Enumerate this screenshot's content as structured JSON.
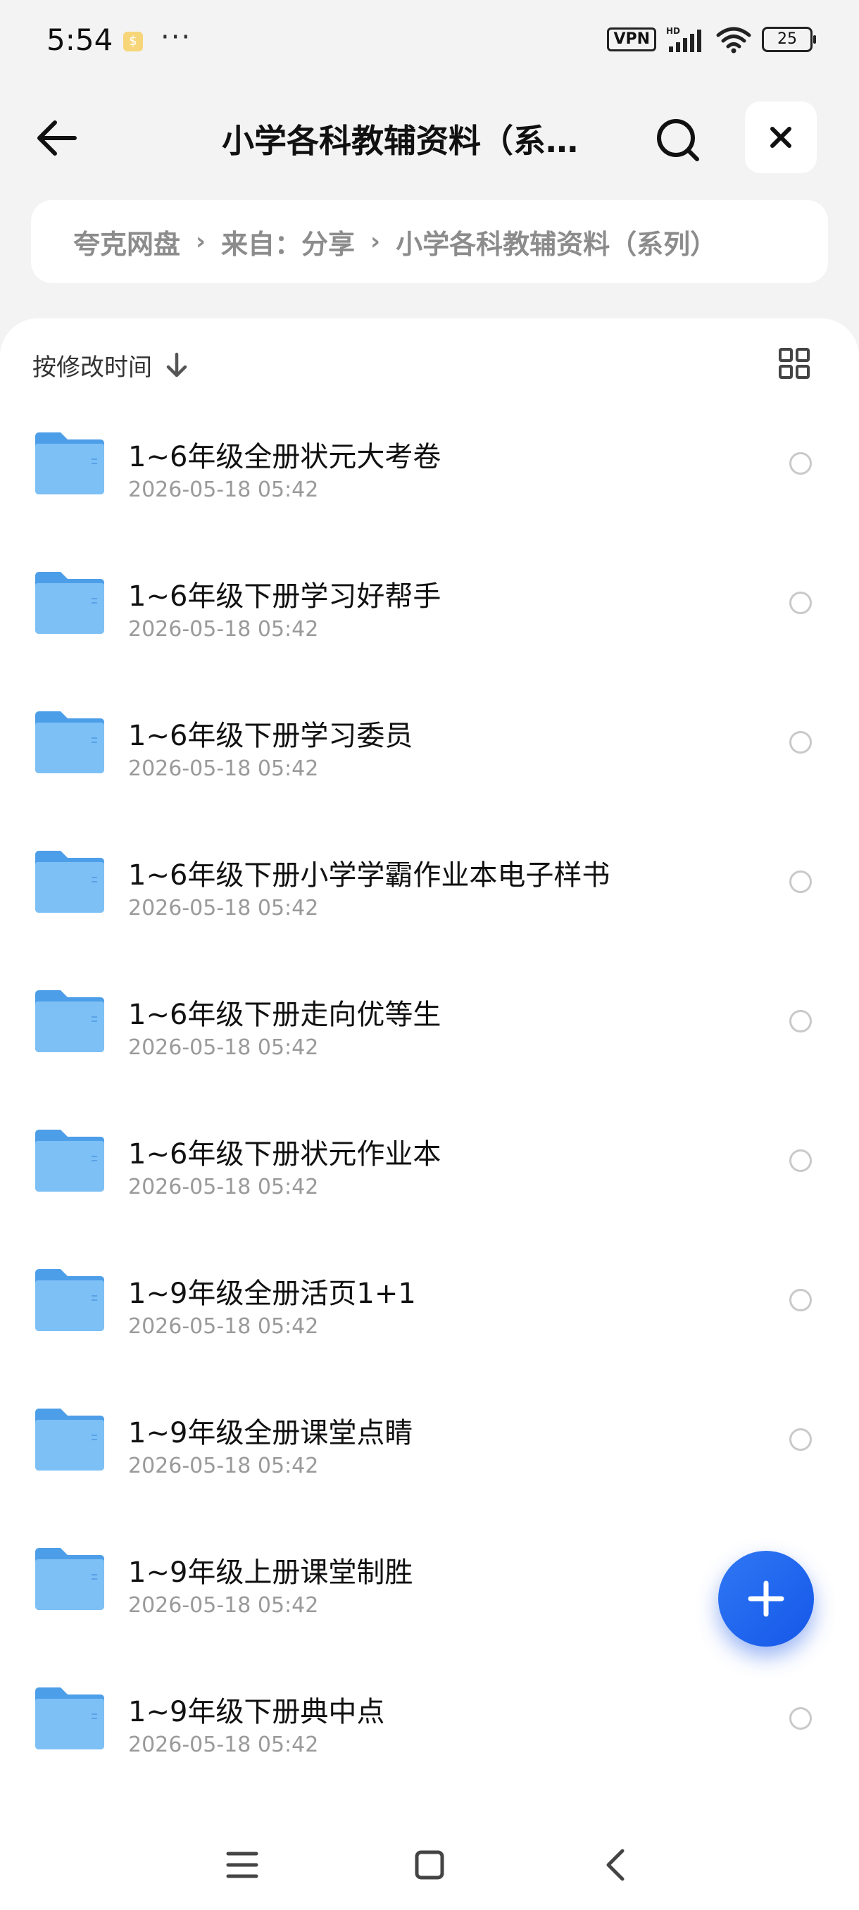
{
  "status_bar": {
    "time": "5:54",
    "dots": "···",
    "vpn": "VPN",
    "battery": "25"
  },
  "header": {
    "title": "小学各科教辅资料（系列）"
  },
  "breadcrumb": {
    "items": [
      "夸克网盘",
      "来自：分享",
      "小学各科教辅资料（系列）"
    ]
  },
  "toolbar": {
    "sort_label": "按修改时间"
  },
  "files": [
    {
      "name": "1~6年级全册状元大考卷",
      "date": "2026-05-18 05:42"
    },
    {
      "name": "1~6年级下册学习好帮手",
      "date": "2026-05-18 05:42"
    },
    {
      "name": "1~6年级下册学习委员",
      "date": "2026-05-18 05:42"
    },
    {
      "name": "1~6年级下册小学学霸作业本电子样书",
      "date": "2026-05-18 05:42"
    },
    {
      "name": "1~6年级下册走向优等生",
      "date": "2026-05-18 05:42"
    },
    {
      "name": "1~6年级下册状元作业本",
      "date": "2026-05-18 05:42"
    },
    {
      "name": "1~9年级全册活页1+1",
      "date": "2026-05-18 05:42"
    },
    {
      "name": "1~9年级全册课堂点睛",
      "date": "2026-05-18 05:42"
    },
    {
      "name": "1~9年级上册课堂制胜",
      "date": "2026-05-18 05:42"
    },
    {
      "name": "1~9年级下册典中点",
      "date": "2026-05-18 05:42"
    }
  ],
  "colors": {
    "accent": "#1f64ef",
    "folder": "#5aa8f0",
    "background": "#f3f3f3"
  },
  "icons": {
    "back": "arrow-left-icon",
    "search": "search-icon",
    "close": "close-icon",
    "sort": "arrow-down-icon",
    "grid": "grid-view-icon",
    "fab": "plus-icon"
  }
}
